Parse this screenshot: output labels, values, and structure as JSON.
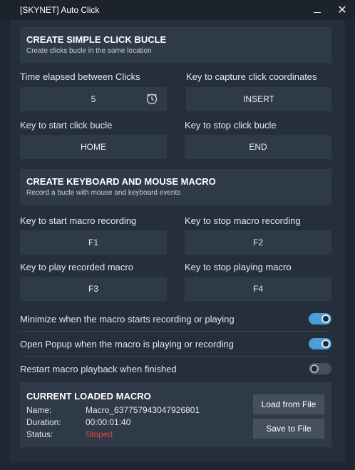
{
  "window": {
    "title": "[SKYNET] Auto Click",
    "minimize_icon": "minimize-icon",
    "close_icon": "close-icon"
  },
  "simple_click": {
    "title": "CREATE SIMPLE CLICK BUCLE",
    "subtitle": "Create clicks bucle in the some location",
    "time_elapsed_label": "Time elapsed between Clicks",
    "time_elapsed_value": "5",
    "time_icon": "clock-icon",
    "capture_label": "Key to capture click coordinates",
    "capture_value": "INSERT",
    "start_label": "Key to start click bucle",
    "start_value": "HOME",
    "stop_label": "Key to stop click bucle",
    "stop_value": "END"
  },
  "macro": {
    "title": "CREATE KEYBOARD AND MOUSE MACRO",
    "subtitle": "Record a bucle with mouse and keyboard events",
    "start_rec_label": "Key to start macro recording",
    "start_rec_value": "F1",
    "stop_rec_label": "Key to stop macro recording",
    "stop_rec_value": "F2",
    "play_label": "Key to play recorded macro",
    "play_value": "F3",
    "stop_play_label": "Key to stop playing macro",
    "stop_play_value": "F4"
  },
  "options": [
    {
      "label": "Minimize when the macro starts recording or playing",
      "enabled": true
    },
    {
      "label": "Open Popup when the macro is playing or recording",
      "enabled": true
    },
    {
      "label": "Restart macro playback when finished",
      "enabled": false
    }
  ],
  "loaded_macro": {
    "title": "CURRENT LOADED MACRO",
    "name_label": "Name:",
    "name_value": "Macro_637757943047926801",
    "duration_label": "Duration:",
    "duration_value": "00:00:01:40",
    "status_label": "Status:",
    "status_value": "Stoped",
    "load_button": "Load from File",
    "save_button": "Save to File"
  },
  "colors": {
    "background": "#1f2732",
    "panel": "#252f3c",
    "field": "#2f3a48",
    "accent": "#4a9fd6",
    "status_error": "#e04545"
  }
}
